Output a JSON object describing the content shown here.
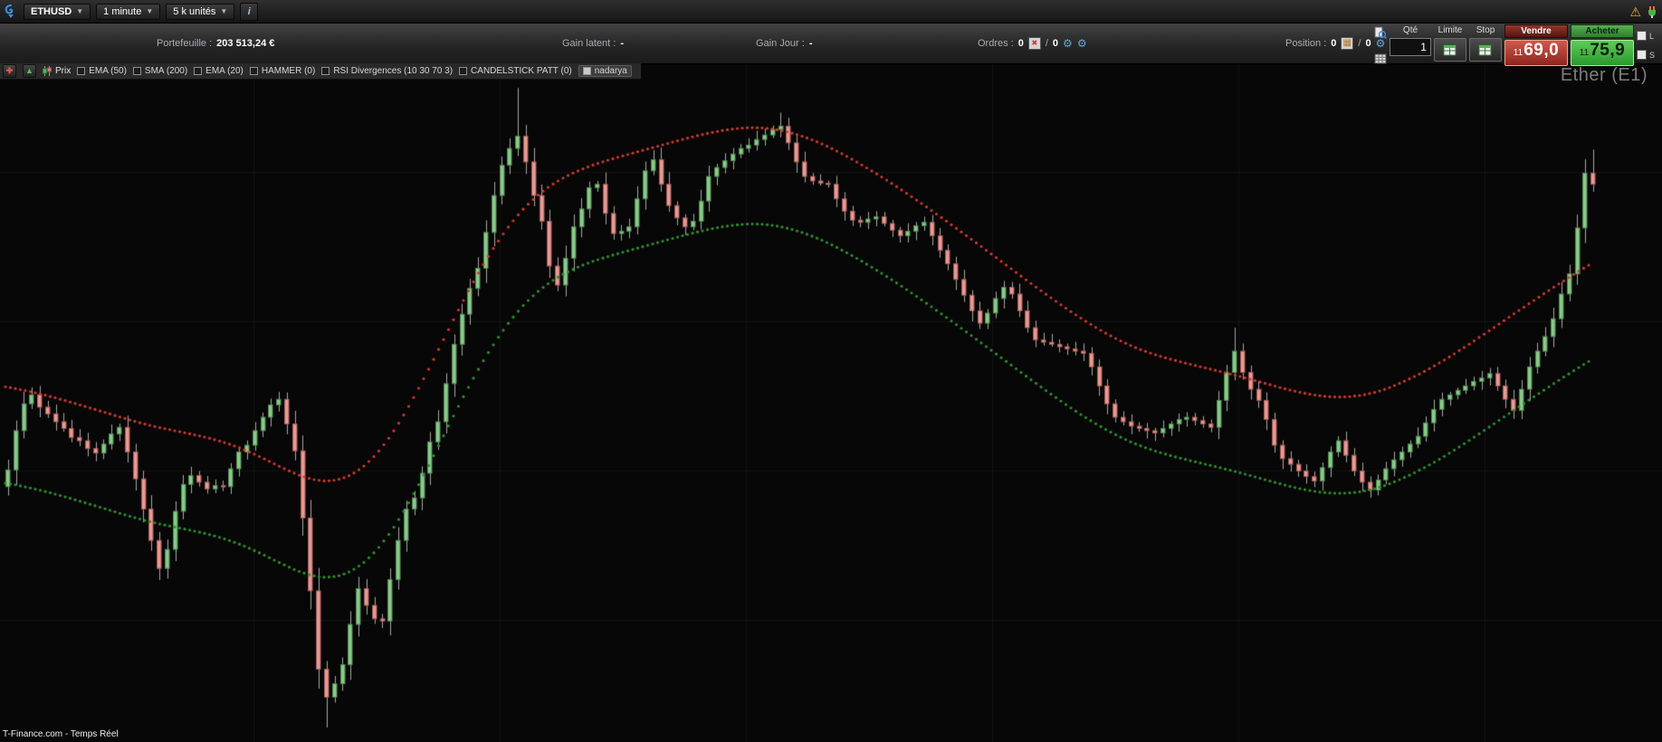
{
  "toolbar": {
    "symbol": "ETHUSD",
    "timeframe": "1 minute",
    "units": "5 k unités",
    "info_glyph": "i",
    "alert_icon": "warning-triangle",
    "connection_icon": "plug"
  },
  "stats": {
    "portfolio_label": "Portefeuille :",
    "portfolio_value": "203 513,24 €",
    "gain_latent_label": "Gain latent :",
    "gain_latent_value": "-",
    "gain_day_label": "Gain Jour :",
    "gain_day_value": "-",
    "orders_label": "Ordres :",
    "orders_count": "0",
    "orders_slash": "/",
    "orders_count2": "0",
    "position_label": "Position :",
    "position_count": "0",
    "position_slash": "/",
    "position_count2": "0"
  },
  "trade_panel": {
    "qty_label": "Qté",
    "qty_value": "1",
    "limit_label": "Limite",
    "stop_label": "Stop",
    "sell_label": "Vendre",
    "sell_price_small": "11",
    "sell_price_big": "69,0",
    "buy_label": "Acheter",
    "buy_price_small": "11",
    "buy_price_big": "75,9",
    "ls_label_1": "L",
    "ls_label_2": "S",
    "colors": {
      "sell_red": "#b8413a",
      "buy_green": "#3cb93c"
    }
  },
  "indicators": {
    "price_label": "Prix",
    "items": [
      {
        "label": "EMA (50)",
        "checked": false
      },
      {
        "label": "SMA (200)",
        "checked": false
      },
      {
        "label": "EMA (20)",
        "checked": false
      },
      {
        "label": "HAMMER (0)",
        "checked": false
      },
      {
        "label": "RSI Divergences (10 30 70 3)",
        "checked": false
      },
      {
        "label": "CANDELSTICK PATT (0)",
        "checked": false
      },
      {
        "label": "nadarya",
        "checked": true
      }
    ]
  },
  "chart": {
    "watermark": "Ether (E1)",
    "footer": "T-Finance.com - Temps Réel"
  },
  "chart_data": {
    "type": "candlestick",
    "symbol": "ETHUSD",
    "interval": "1 minute",
    "y_range": [
      1128,
      1188.6
    ],
    "first_open": 1150.8,
    "band_spread": 4.3,
    "overlays": [
      {
        "name": "nadarya upper band",
        "style": "dotted",
        "color": "#cd3a2e"
      },
      {
        "name": "nadarya lower band",
        "style": "dotted",
        "color": "#2f8f2f"
      }
    ],
    "colors": {
      "up_fill": "#8cc98c",
      "up_border": "#4e8a50",
      "down_fill": "#e69b96",
      "down_border": "#a85a55",
      "wick": "#a8a8a8",
      "band_upper": "#cd3a2e",
      "band_lower": "#2f8f2f",
      "background": "#070707",
      "grid": "rgba(255,255,255,0.05)"
    },
    "closes": [
      1152.3,
      1155.8,
      1158.2,
      1159.0,
      1157.9,
      1157.3,
      1156.6,
      1156.0,
      1155.2,
      1154.9,
      1154.2,
      1153.8,
      1154.6,
      1155.5,
      1156.1,
      1153.9,
      1151.5,
      1148.8,
      1146.0,
      1143.5,
      1145.2,
      1148.6,
      1151.0,
      1151.8,
      1151.2,
      1150.6,
      1150.9,
      1150.8,
      1152.4,
      1153.9,
      1154.5,
      1155.8,
      1157.0,
      1158.1,
      1158.6,
      1156.4,
      1154.0,
      1148.0,
      1141.5,
      1134.5,
      1132.0,
      1133.2,
      1134.9,
      1138.5,
      1141.7,
      1140.2,
      1139.0,
      1138.8,
      1142.5,
      1146.0,
      1148.8,
      1149.8,
      1152.0,
      1154.8,
      1156.6,
      1160.0,
      1163.5,
      1166.2,
      1168.5,
      1170.3,
      1173.5,
      1176.8,
      1179.5,
      1181.0,
      1182.1,
      1179.8,
      1176.8,
      1174.5,
      1170.5,
      1168.8,
      1171.2,
      1174.0,
      1175.6,
      1177.5,
      1177.8,
      1175.2,
      1173.4,
      1173.6,
      1174.0,
      1176.5,
      1179.0,
      1180.0,
      1177.8,
      1175.9,
      1174.8,
      1174.0,
      1174.5,
      1176.3,
      1178.5,
      1179.3,
      1179.9,
      1180.5,
      1181.0,
      1181.3,
      1181.8,
      1182.2,
      1182.7,
      1183.0,
      1181.5,
      1179.8,
      1178.5,
      1178.1,
      1177.9,
      1177.8,
      1176.5,
      1175.4,
      1174.6,
      1174.4,
      1174.7,
      1174.9,
      1174.3,
      1173.7,
      1173.2,
      1173.6,
      1174.1,
      1174.4,
      1173.2,
      1171.9,
      1170.7,
      1169.3,
      1167.9,
      1166.5,
      1165.4,
      1166.3,
      1167.6,
      1168.6,
      1168.0,
      1166.5,
      1165.0,
      1163.9,
      1163.7,
      1163.5,
      1163.3,
      1163.1,
      1162.9,
      1162.7,
      1161.5,
      1159.8,
      1158.2,
      1157.0,
      1156.6,
      1156.2,
      1156.0,
      1155.8,
      1155.6,
      1156.0,
      1156.4,
      1156.8,
      1157.0,
      1156.7,
      1156.4,
      1156.1,
      1158.5,
      1161.0,
      1162.9,
      1161.0,
      1159.5,
      1158.5,
      1156.8,
      1154.5,
      1153.3,
      1152.8,
      1152.2,
      1151.7,
      1151.3,
      1152.5,
      1153.9,
      1154.9,
      1153.6,
      1152.2,
      1151.2,
      1150.5,
      1151.4,
      1152.4,
      1153.2,
      1153.9,
      1154.6,
      1155.3,
      1156.5,
      1157.7,
      1158.6,
      1159.0,
      1159.4,
      1159.8,
      1160.2,
      1160.5,
      1160.9,
      1159.8,
      1158.6,
      1157.6,
      1159.5,
      1161.5,
      1162.9,
      1164.2,
      1165.8,
      1168.0,
      1169.8,
      1173.9,
      1178.8,
      1177.8
    ],
    "wick_overrides": {
      "40": {
        "low": 1129.3
      },
      "64": {
        "high": 1186.4
      },
      "97": {
        "high": 1184.2
      },
      "154": {
        "high": 1165.0
      },
      "199": {
        "high": 1180.9
      }
    }
  }
}
